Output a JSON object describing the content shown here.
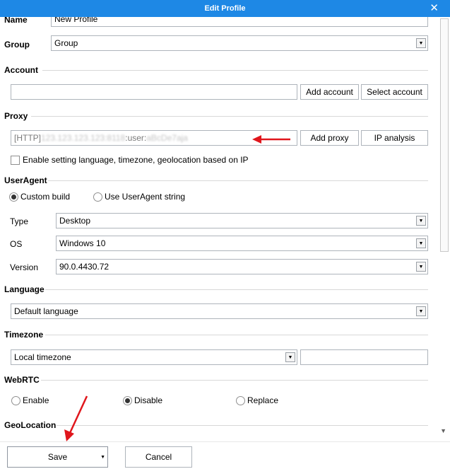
{
  "window": {
    "title": "Edit Profile"
  },
  "profile": {
    "name_label": "Name",
    "name_value": "New Profile",
    "group_label": "Group",
    "group_value": "Group"
  },
  "account": {
    "section_title": "Account",
    "add_button": "Add account",
    "select_button": "Select account"
  },
  "proxy": {
    "section_title": "Proxy",
    "value_prefix": "[HTTP]",
    "value_mid": ":user:",
    "add_button": "Add proxy",
    "analysis_button": "IP analysis",
    "geo_checkbox": "Enable setting language, timezone, geolocation based on IP"
  },
  "useragent": {
    "section_title": "UserAgent",
    "radio_custom": "Custom build",
    "radio_string": "Use UserAgent string",
    "type_label": "Type",
    "type_value": "Desktop",
    "os_label": "OS",
    "os_value": "Windows 10",
    "version_label": "Version",
    "version_value": "90.0.4430.72"
  },
  "language": {
    "section_title": "Language",
    "value": "Default language"
  },
  "timezone": {
    "section_title": "Timezone",
    "value": "Local timezone"
  },
  "webrtc": {
    "section_title": "WebRTC",
    "enable": "Enable",
    "disable": "Disable",
    "replace": "Replace"
  },
  "geolocation": {
    "section_title": "GeoLocation"
  },
  "footer": {
    "save": "Save",
    "cancel": "Cancel"
  },
  "colors": {
    "titlebar": "#1e88e5",
    "arrow": "#e0161c"
  }
}
